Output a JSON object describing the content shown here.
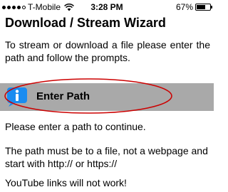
{
  "status_bar": {
    "carrier": "T-Mobile",
    "time": "3:28 PM",
    "battery_percent": "67%",
    "battery_level": 0.67,
    "signal_bars_filled": 4,
    "signal_bars_total": 5,
    "icons": [
      "signal-dots-icon",
      "wifi-icon",
      "battery-icon"
    ]
  },
  "wizard": {
    "title": "Download / Stream Wizard",
    "intro": "To stream or download a file please enter the path and follow the prompts."
  },
  "path_row": {
    "icon": "info-icon",
    "label": "Enter Path",
    "icon_color": "#1a8cf0",
    "bar_color": "#a9a9a9",
    "annotation_color": "#cc0000"
  },
  "messages": {
    "prompt": "Please enter a path to continue.",
    "requirement": "The path must be to a file, not a webpage and start with http:// or https://",
    "warning": "YouTube links will not work!"
  }
}
